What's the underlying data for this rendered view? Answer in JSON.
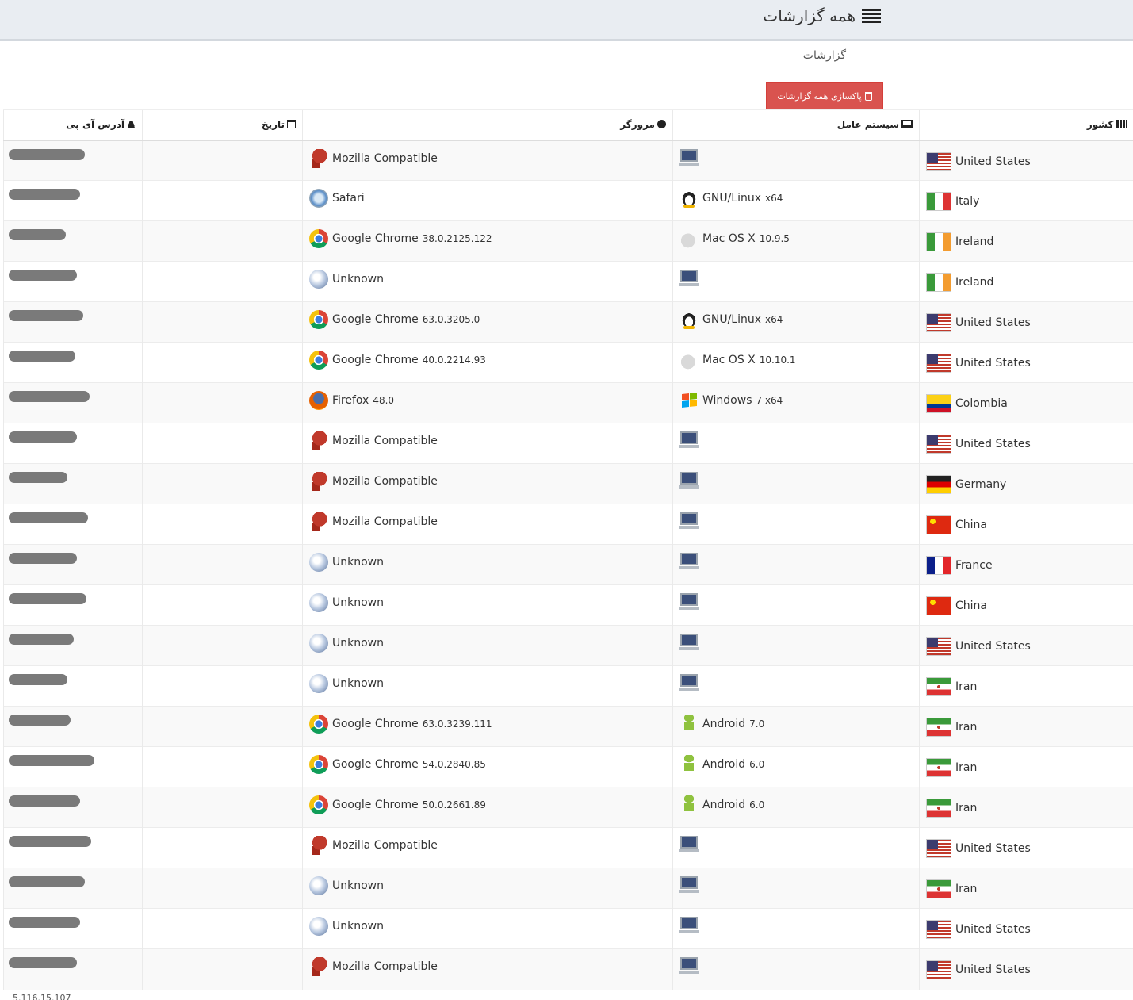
{
  "header": {
    "title": "همه گزارشات"
  },
  "section": {
    "subtitle": "گزارشات",
    "clear_button": "پاکسازی همه گزارشات"
  },
  "columns": {
    "ip": "آدرس آی پی",
    "date": "تاریخ",
    "browser": "مرورگر",
    "os": "سیستم عامل",
    "country": "کشور"
  },
  "rows": [
    {
      "browser": "Mozilla Compatible",
      "browser_ver": "",
      "browser_icon": "mozilla-icon",
      "os": "",
      "os_ver": "",
      "os_icon": "computer-icon",
      "country": "United States",
      "flag": "us",
      "ip_w": 96
    },
    {
      "browser": "Safari",
      "browser_ver": "",
      "browser_icon": "safari-icon",
      "os": "GNU/Linux",
      "os_ver": "x64",
      "os_icon": "linux-icon",
      "country": "Italy",
      "flag": "it",
      "ip_w": 90
    },
    {
      "browser": "Google Chrome",
      "browser_ver": "38.0.2125.122",
      "browser_icon": "chrome-icon",
      "os": "Mac OS X",
      "os_ver": "10.9.5",
      "os_icon": "apple-icon",
      "country": "Ireland",
      "flag": "ie",
      "ip_w": 72
    },
    {
      "browser": "Unknown",
      "browser_ver": "",
      "browser_icon": "unknown-browser-icon",
      "os": "",
      "os_ver": "",
      "os_icon": "computer-icon",
      "country": "Ireland",
      "flag": "ie",
      "ip_w": 86
    },
    {
      "browser": "Google Chrome",
      "browser_ver": "63.0.3205.0",
      "browser_icon": "chrome-icon",
      "os": "GNU/Linux",
      "os_ver": "x64",
      "os_icon": "linux-icon",
      "country": "United States",
      "flag": "us",
      "ip_w": 94
    },
    {
      "browser": "Google Chrome",
      "browser_ver": "40.0.2214.93",
      "browser_icon": "chrome-icon",
      "os": "Mac OS X",
      "os_ver": "10.10.1",
      "os_icon": "apple-icon",
      "country": "United States",
      "flag": "us",
      "ip_w": 84
    },
    {
      "browser": "Firefox",
      "browser_ver": "48.0",
      "browser_icon": "firefox-icon",
      "os": "Windows",
      "os_ver": "7 x64",
      "os_icon": "windows-icon",
      "country": "Colombia",
      "flag": "co",
      "ip_w": 102
    },
    {
      "browser": "Mozilla Compatible",
      "browser_ver": "",
      "browser_icon": "mozilla-icon",
      "os": "",
      "os_ver": "",
      "os_icon": "computer-icon",
      "country": "United States",
      "flag": "us",
      "ip_w": 86
    },
    {
      "browser": "Mozilla Compatible",
      "browser_ver": "",
      "browser_icon": "mozilla-icon",
      "os": "",
      "os_ver": "",
      "os_icon": "computer-icon",
      "country": "Germany",
      "flag": "de",
      "ip_w": 74
    },
    {
      "browser": "Mozilla Compatible",
      "browser_ver": "",
      "browser_icon": "mozilla-icon",
      "os": "",
      "os_ver": "",
      "os_icon": "computer-icon",
      "country": "China",
      "flag": "cn",
      "ip_w": 100
    },
    {
      "browser": "Unknown",
      "browser_ver": "",
      "browser_icon": "unknown-browser-icon",
      "os": "",
      "os_ver": "",
      "os_icon": "computer-icon",
      "country": "France",
      "flag": "fr",
      "ip_w": 86
    },
    {
      "browser": "Unknown",
      "browser_ver": "",
      "browser_icon": "unknown-browser-icon",
      "os": "",
      "os_ver": "",
      "os_icon": "computer-icon",
      "country": "China",
      "flag": "cn",
      "ip_w": 98
    },
    {
      "browser": "Unknown",
      "browser_ver": "",
      "browser_icon": "unknown-browser-icon",
      "os": "",
      "os_ver": "",
      "os_icon": "computer-icon",
      "country": "United States",
      "flag": "us",
      "ip_w": 82
    },
    {
      "browser": "Unknown",
      "browser_ver": "",
      "browser_icon": "unknown-browser-icon",
      "os": "",
      "os_ver": "",
      "os_icon": "computer-icon",
      "country": "Iran",
      "flag": "ir",
      "ip_w": 74
    },
    {
      "browser": "Google Chrome",
      "browser_ver": "63.0.3239.111",
      "browser_icon": "chrome-icon",
      "os": "Android",
      "os_ver": "7.0",
      "os_icon": "android-icon",
      "country": "Iran",
      "flag": "ir",
      "ip_w": 78
    },
    {
      "browser": "Google Chrome",
      "browser_ver": "54.0.2840.85",
      "browser_icon": "chrome-icon",
      "os": "Android",
      "os_ver": "6.0",
      "os_icon": "android-icon",
      "country": "Iran",
      "flag": "ir",
      "ip_w": 108
    },
    {
      "browser": "Google Chrome",
      "browser_ver": "50.0.2661.89",
      "browser_icon": "chrome-icon",
      "os": "Android",
      "os_ver": "6.0",
      "os_icon": "android-icon",
      "country": "Iran",
      "flag": "ir",
      "ip_w": 90
    },
    {
      "browser": "Mozilla Compatible",
      "browser_ver": "",
      "browser_icon": "mozilla-icon",
      "os": "",
      "os_ver": "",
      "os_icon": "computer-icon",
      "country": "United States",
      "flag": "us",
      "ip_w": 104
    },
    {
      "browser": "Unknown",
      "browser_ver": "",
      "browser_icon": "unknown-browser-icon",
      "os": "",
      "os_ver": "",
      "os_icon": "computer-icon",
      "country": "Iran",
      "flag": "ir",
      "ip_w": 96
    },
    {
      "browser": "Unknown",
      "browser_ver": "",
      "browser_icon": "unknown-browser-icon",
      "os": "",
      "os_ver": "",
      "os_icon": "computer-icon",
      "country": "United States",
      "flag": "us",
      "ip_w": 90
    },
    {
      "browser": "Mozilla Compatible",
      "browser_ver": "",
      "browser_icon": "mozilla-icon",
      "os": "",
      "os_ver": "",
      "os_icon": "computer-icon",
      "country": "United States",
      "flag": "us",
      "ip_w": 86
    }
  ],
  "partial_row_ip": "5.116.15.107"
}
